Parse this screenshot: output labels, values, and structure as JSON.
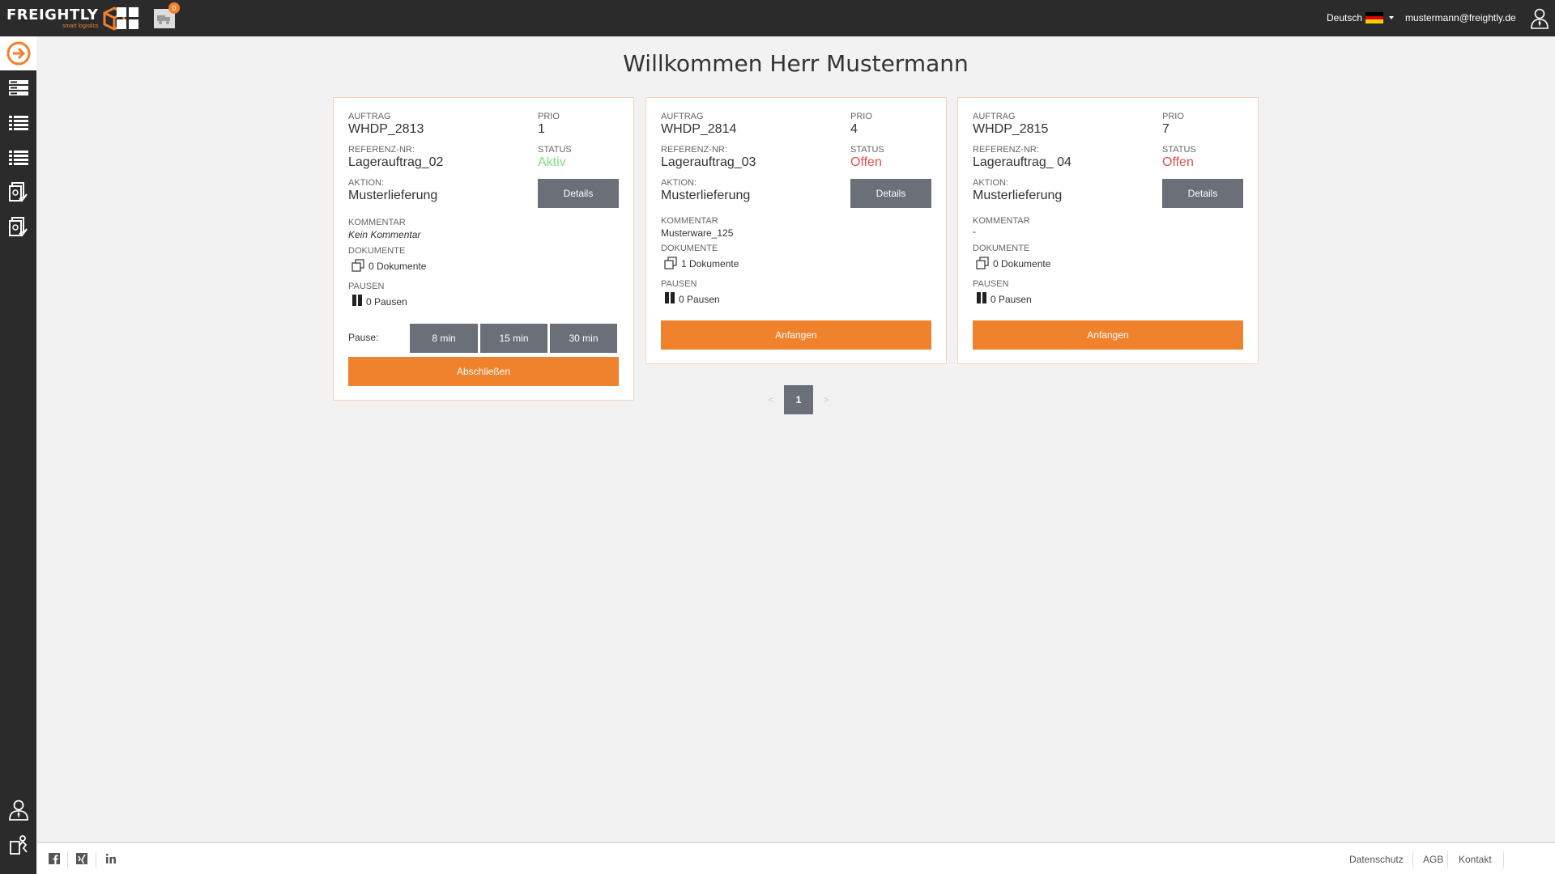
{
  "topbar": {
    "logo_main": "FREIGHTLY",
    "logo_sub": "smart logistics",
    "inbox_count": "0",
    "language": "Deutsch",
    "user_email": "mustermann@freightly.de"
  },
  "colors": {
    "accent": "#f0822e",
    "dark": "#2b2b2b",
    "button_gray": "#6b6f78",
    "status_active": "#7ee07e",
    "status_open": "#d9534f"
  },
  "page": {
    "title": "Willkommen Herr Mustermann"
  },
  "labels": {
    "auftrag": "AUFTRAG",
    "prio": "PRIO",
    "referenz": "REFERENZ-NR:",
    "status": "STATUS",
    "aktion": "AKTION:",
    "kommentar": "KOMMENTAR",
    "dokumente": "DOKUMENTE",
    "pausen": "PAUSEN",
    "details": "Details",
    "pause": "Pause:",
    "abschliessen": "Abschließen",
    "anfangen": "Anfangen"
  },
  "cards": [
    {
      "auftrag": "WHDP_2813",
      "prio": "1",
      "referenz": "Lagerauftrag_02",
      "status": "Aktiv",
      "aktion": "Musterlieferung",
      "kommentar": "Kein Kommentar",
      "dokumente": "0 Dokumente",
      "pausen": "0 Pausen",
      "pause_options": [
        "8 min",
        "15 min",
        "30 min"
      ]
    },
    {
      "auftrag": "WHDP_2814",
      "prio": "4",
      "referenz": "Lagerauftrag_03",
      "status": "Offen",
      "aktion": "Musterlieferung",
      "kommentar": "Musterware_125",
      "dokumente": "1 Dokumente",
      "pausen": "0 Pausen"
    },
    {
      "auftrag": "WHDP_2815",
      "prio": "7",
      "referenz": "Lagerauftrag_ 04",
      "status": "Offen",
      "aktion": "Musterlieferung",
      "kommentar": "-",
      "dokumente": "0 Dokumente",
      "pausen": "0 Pausen"
    }
  ],
  "pagination": {
    "prev": "<",
    "current": "1",
    "next": ">"
  },
  "footer": {
    "links": [
      "Datenschutz",
      "AGB",
      "Kontakt"
    ]
  }
}
